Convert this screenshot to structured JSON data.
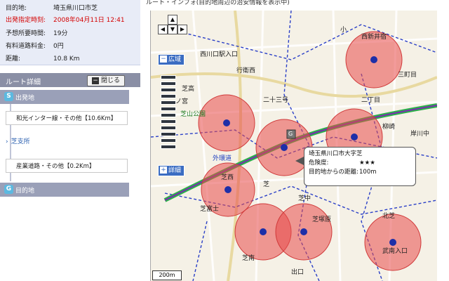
{
  "top_title": "ルート・インフォ(目的地周辺の治安情報を表示中)",
  "info": {
    "rows": [
      {
        "key": "目的地:",
        "value": "埼玉県川口市芝",
        "red": false
      },
      {
        "key": "出発指定時刻:",
        "value": "2008年04月11日 12:41",
        "red": true
      },
      {
        "key": "予想所要時間:",
        "value": "19分",
        "red": false
      },
      {
        "key": "有料道路料金:",
        "value": "0円",
        "red": false
      },
      {
        "key": "距離:",
        "value": "10.8 Km",
        "red": false
      }
    ]
  },
  "route": {
    "header": "ルート詳細",
    "close_label": "閉じる",
    "start_badge": "S",
    "start_label": "出発地",
    "road1": "和光インター線・その他【10.6Km】",
    "stop_label": "芝支所",
    "road2": "産業道路・その他【0.2Km】",
    "goal_badge": "G",
    "goal_label": "目的地"
  },
  "map": {
    "zoom_wide_label": "広域",
    "zoom_detail_label": "詳細",
    "scale_label": "200m",
    "pad_up": "▲",
    "pad_down": "▼",
    "pad_left": "◀",
    "pad_right": "▶",
    "place_labels": [
      {
        "text": "西川口駅入口",
        "color": "black"
      },
      {
        "text": "行衛西",
        "color": "black"
      },
      {
        "text": "西新井宿",
        "color": "black"
      },
      {
        "text": "三町目",
        "color": "black"
      },
      {
        "text": "芝高",
        "color": "black"
      },
      {
        "text": "ノ宮",
        "color": "black"
      },
      {
        "text": "小",
        "color": "black"
      },
      {
        "text": "二十三号",
        "color": "black"
      },
      {
        "text": "芝西",
        "color": "black"
      },
      {
        "text": "二丁目",
        "color": "black"
      },
      {
        "text": "芝中",
        "color": "black"
      },
      {
        "text": "柳崎",
        "color": "black"
      },
      {
        "text": "芝富士",
        "color": "black"
      },
      {
        "text": "芝南",
        "color": "black"
      },
      {
        "text": "芝",
        "color": "black"
      },
      {
        "text": "北芝",
        "color": "black"
      },
      {
        "text": "芝塚原",
        "color": "black"
      },
      {
        "text": "岸川中",
        "color": "black"
      },
      {
        "text": "芝山公園",
        "color": "green"
      },
      {
        "text": "外環道",
        "color": "blue"
      },
      {
        "text": "武南入口",
        "color": "black"
      },
      {
        "text": "出口",
        "color": "black"
      }
    ],
    "info_balloon": {
      "line1": "埼玉県川口市大字芝",
      "danger_key": "危険度:",
      "danger_value": "★★★",
      "dist_key": "目的地からの距離:",
      "dist_value": "100m"
    },
    "goal_marker": "G",
    "danger_zones": [
      {
        "name": "zone-1",
        "level": 3
      },
      {
        "name": "zone-2",
        "level": 3
      },
      {
        "name": "zone-3",
        "level": 3
      },
      {
        "name": "zone-4",
        "level": 3
      },
      {
        "name": "zone-5",
        "level": 3
      },
      {
        "name": "zone-6",
        "level": 3
      },
      {
        "name": "zone-7",
        "level": 3
      },
      {
        "name": "zone-8",
        "level": 3
      },
      {
        "name": "zone-9",
        "level": 3
      }
    ],
    "colors": {
      "danger_circle": "#e84a4a",
      "route_line": "#7b2bb0",
      "expressway": "#2bb04a",
      "boundary": "#2a3fc7",
      "map_bg": "#f5f1e6"
    }
  }
}
